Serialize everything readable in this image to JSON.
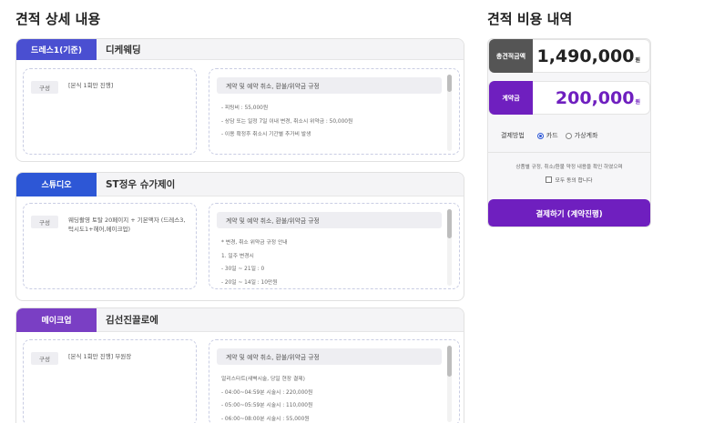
{
  "detail_title": "견적 상세 내용",
  "cost_title": "견적 비용 내역",
  "vendors": [
    {
      "badge": "드레스1(기준)",
      "badge_color": "#4a4fd1",
      "name": "디케웨딩",
      "composition_tag": "구성",
      "composition_text": "[본식 1회만 진행]",
      "policy_title": "계약 및 예약 취소, 환불/위약금 규정",
      "policy_lines": [
        "- 피팅비 : 55,000원",
        "- 상담 또는 일정 7일 이내 변경, 취소시 위약금 : 50,000원",
        "- 이용 확정후 취소시 기간별 추가비 발생"
      ]
    },
    {
      "badge": "스튜디오",
      "badge_color": "#2d57d6",
      "name": "ST정우 슈가제이",
      "composition_tag": "구성",
      "composition_text": "웨딩촬영 토탈 20페이지 + 기본액자 (드레스3, 턱시도1+헤어,메이크업)",
      "policy_title": "계약 및 예약 취소, 환불/위약금 규정",
      "policy_lines": [
        "* 변경, 취소 위약금 규정 안내",
        "1. 일주 변경시",
        "- 30일 ~ 21일 : 0",
        "- 20일 ~ 14일 : 10만원"
      ]
    },
    {
      "badge": "메이크업",
      "badge_color": "#7a3fc4",
      "name": "김선진끌로에",
      "composition_tag": "구성",
      "composition_text": "[본식 1회만 진행] 부원장",
      "policy_title": "계약 및 예약 취소, 환불/위약금 규정",
      "policy_lines": [
        "얼리스타트(새벽시술, 당일 현장 결제)",
        "- 04:00~04:59분 시술시 : 220,000원",
        "- 05:00~05:59분 시술시 : 110,000원",
        "- 06:00~08:00분 시술시 : 55,000원"
      ]
    }
  ],
  "cost": {
    "total_label": "총견적금액",
    "total_amount": "1,490,000",
    "total_unit": "원",
    "total_label_color": "#555555",
    "deposit_label": "계약금",
    "deposit_amount": "200,000",
    "deposit_unit": "원",
    "deposit_color": "#6f1fbf",
    "payment_label": "결제방법",
    "payment_options": [
      {
        "label": "카드",
        "selected": true
      },
      {
        "label": "가상계좌",
        "selected": false
      }
    ],
    "agree_note": "상품별 규정, 취소/환불 약정 내용을 확인 하였으며",
    "agree_label": "모두 동의 합니다",
    "pay_button": "결제하기 (계약진행)"
  }
}
